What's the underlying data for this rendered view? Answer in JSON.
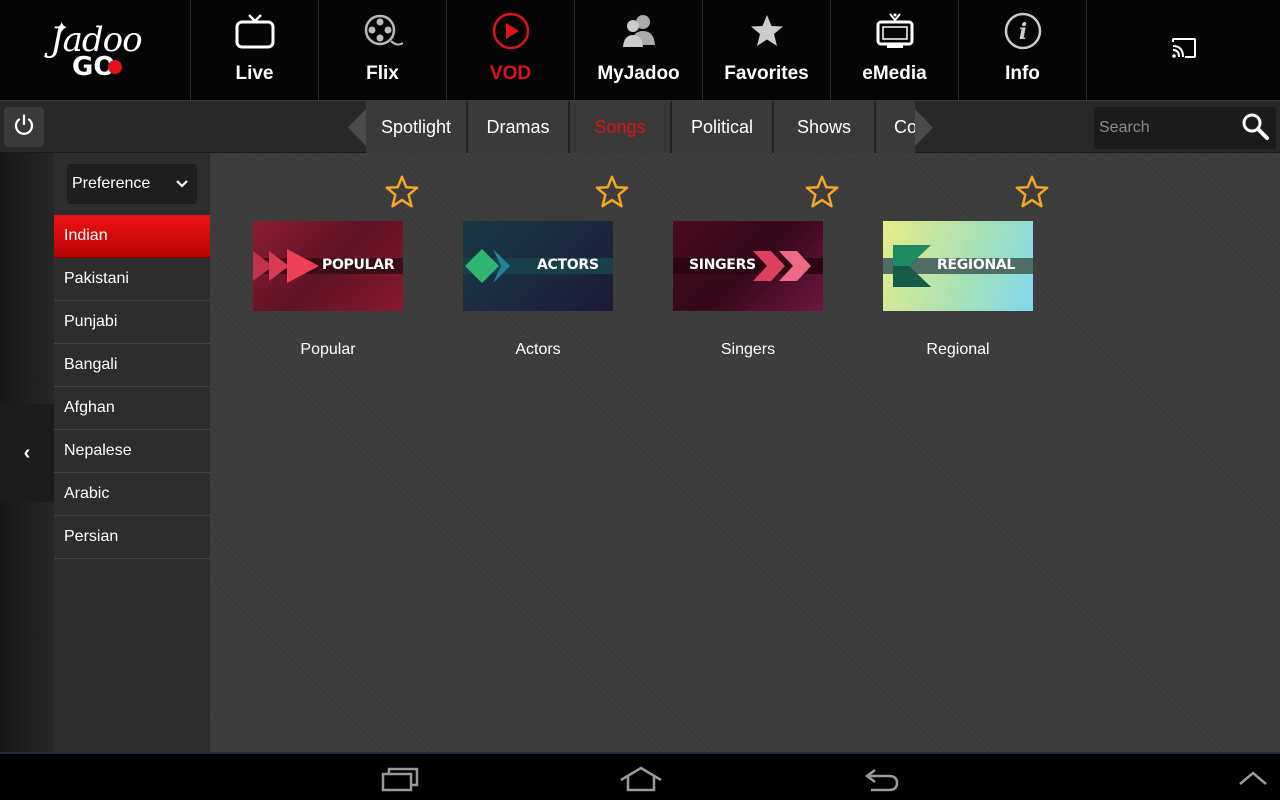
{
  "app": {
    "logo_text_top": "Jadoo",
    "logo_text_bottom": "GO"
  },
  "nav": {
    "tabs": [
      {
        "label": "Live",
        "icon": "tv-icon",
        "active": false
      },
      {
        "label": "Flix",
        "icon": "film-reel-icon",
        "active": false
      },
      {
        "label": "VOD",
        "icon": "play-circle-icon",
        "active": true
      },
      {
        "label": "MyJadoo",
        "icon": "users-icon",
        "active": false
      },
      {
        "label": "Favorites",
        "icon": "star-icon",
        "active": false
      },
      {
        "label": "eMedia",
        "icon": "tv-signal-icon",
        "active": false
      },
      {
        "label": "Info",
        "icon": "info-icon",
        "active": false
      }
    ],
    "cast_icon": "cast-icon"
  },
  "categories": {
    "items": [
      {
        "label": "Spotlight",
        "active": false
      },
      {
        "label": "Dramas",
        "active": false
      },
      {
        "label": "Songs",
        "active": true
      },
      {
        "label": "Political",
        "active": false
      },
      {
        "label": "Shows",
        "active": false
      },
      {
        "label": "Co",
        "active": false
      }
    ]
  },
  "search": {
    "placeholder": "Search",
    "value": ""
  },
  "sidebar": {
    "preference_label": "Preference",
    "filters": [
      {
        "label": "Indian",
        "active": true
      },
      {
        "label": "Pakistani",
        "active": false
      },
      {
        "label": "Punjabi",
        "active": false
      },
      {
        "label": "Bangali",
        "active": false
      },
      {
        "label": "Afghan",
        "active": false
      },
      {
        "label": "Nepalese",
        "active": false
      },
      {
        "label": "Arabic",
        "active": false
      },
      {
        "label": "Persian",
        "active": false
      }
    ],
    "collapse_glyph": "‹"
  },
  "content": {
    "tiles": [
      {
        "title": "Popular",
        "thumb_text": "POPULAR"
      },
      {
        "title": "Actors",
        "thumb_text": "ACTORS"
      },
      {
        "title": "Singers",
        "thumb_text": "SINGERS"
      },
      {
        "title": "Regional",
        "thumb_text": "REGIONAL"
      }
    ]
  },
  "colors": {
    "accent": "#e0121b",
    "star": "#f5a623",
    "background": "#3c3c3c"
  }
}
